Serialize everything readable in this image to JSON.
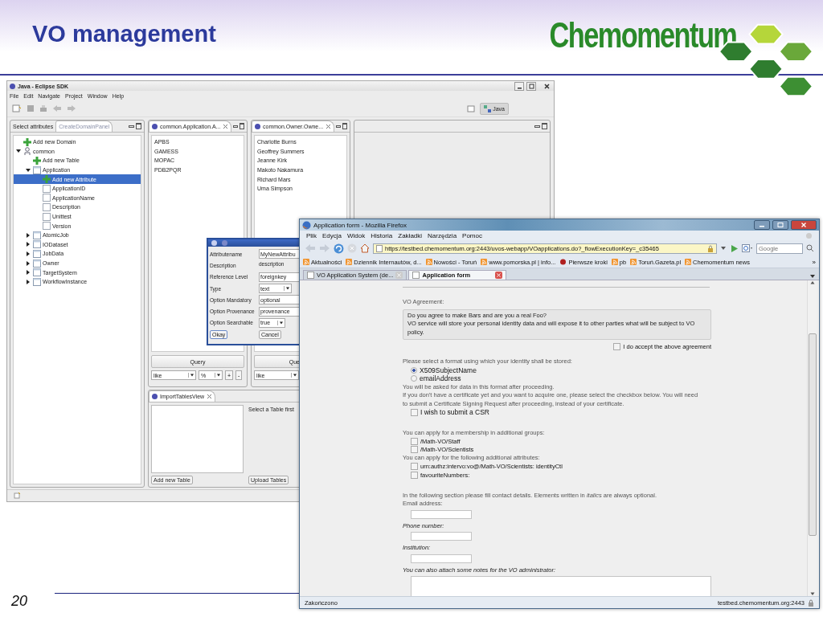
{
  "slide": {
    "title": "VO management",
    "logo": "Chemomentum",
    "page_number": "20"
  },
  "eclipse": {
    "title": "Java - Eclipse SDK",
    "menu": [
      "File",
      "Edit",
      "Navigate",
      "Project",
      "Window",
      "Help"
    ],
    "perspective": "Java",
    "left_tabs": [
      {
        "label": "Select attributes",
        "selected": false
      },
      {
        "label": "CreateDomainPanel",
        "selected": true
      }
    ],
    "tree": [
      {
        "label": "Add new Domain",
        "kind": "add",
        "selected": false
      },
      {
        "label": "common",
        "kind": "db",
        "selected": false,
        "expanded": true,
        "children": [
          {
            "label": "Add new Table",
            "kind": "add",
            "selected": false
          },
          {
            "label": "Application",
            "kind": "table",
            "selected": false,
            "expanded": true,
            "children": [
              {
                "label": "Add new Attribute",
                "kind": "add",
                "selected": true
              },
              {
                "label": "ApplicationID",
                "kind": "field",
                "selected": false
              },
              {
                "label": "ApplicationName",
                "kind": "field",
                "selected": false
              },
              {
                "label": "Description",
                "kind": "field",
                "selected": false
              },
              {
                "label": "Unittest",
                "kind": "field",
                "selected": false
              },
              {
                "label": "Version",
                "kind": "field",
                "selected": false
              }
            ]
          },
          {
            "label": "AtomicJob",
            "kind": "table",
            "selected": false,
            "expanded": false
          },
          {
            "label": "IODataset",
            "kind": "table",
            "selected": false,
            "expanded": false
          },
          {
            "label": "JobData",
            "kind": "table",
            "selected": false,
            "expanded": false
          },
          {
            "label": "Owner",
            "kind": "table",
            "selected": false,
            "expanded": false
          },
          {
            "label": "TargetSystem",
            "kind": "table",
            "selected": false,
            "expanded": false
          },
          {
            "label": "WorkflowInstance",
            "kind": "table",
            "selected": false,
            "expanded": false
          }
        ]
      }
    ],
    "views": [
      {
        "tab": "common.Application.A...",
        "items": [
          "APBS",
          "GAMESS",
          "MOPAC",
          "PDB2PQR"
        ],
        "query_button": "Query",
        "operator": "like",
        "pattern": "%",
        "buttons": [
          "+",
          "-"
        ]
      },
      {
        "tab": "common.Owner.Owne...",
        "items": [
          "Charlotte Burns",
          "Geoffrey Summers",
          "Jeanne Kirk",
          "Makoto Nakamura",
          "Richard Mars",
          "Uma Simpson"
        ],
        "query_button": "Que",
        "operator": "like"
      }
    ],
    "import_view": {
      "tab": "ImportTablesView",
      "hint": "Select a Table first",
      "buttons": [
        "Add new Table",
        "Upload Tables"
      ]
    }
  },
  "dialog": {
    "fields": [
      {
        "label": "Attributename",
        "kind": "text",
        "value": "MyNewAttribu"
      },
      {
        "label": "Description",
        "kind": "area",
        "value": "description"
      },
      {
        "label": "Reference Level",
        "kind": "text",
        "value": "foreignkey"
      },
      {
        "label": "Type",
        "kind": "select",
        "value": "text"
      },
      {
        "label": "Option Mandatory",
        "kind": "text",
        "value": "optional"
      },
      {
        "label": "Option Provenance",
        "kind": "text",
        "value": "provenance"
      },
      {
        "label": "Option Searchable",
        "kind": "select",
        "value": "true"
      }
    ],
    "buttons": [
      "Okay",
      "Cancel"
    ]
  },
  "firefox": {
    "title": "Application form - Mozilla Firefox",
    "menu": [
      "Plik",
      "Edycja",
      "Widok",
      "Historia",
      "Zakładki",
      "Narzędzia",
      "Pomoc"
    ],
    "url": "https://testbed.chemomentum.org:2443/uvos-webapp/VOapplications.do?_flowExecutionKey=_c35465",
    "search_placeholder": "Google",
    "bookmarks": [
      {
        "label": "Aktualności",
        "kind": "feed"
      },
      {
        "label": "Dziennik Internautów, d...",
        "kind": "feed"
      },
      {
        "label": "Nowości - Toruń",
        "kind": "feed"
      },
      {
        "label": "www.pomorska.pl | info...",
        "kind": "feed"
      },
      {
        "label": "Pierwsze kroki",
        "kind": "page"
      },
      {
        "label": "pb",
        "kind": "feed"
      },
      {
        "label": "Toruń.Gazeta.pl",
        "kind": "feed"
      },
      {
        "label": "Chemomentum news",
        "kind": "feed"
      }
    ],
    "bookmarks_more": "»",
    "tabs": [
      {
        "label": "VO Application System (de...",
        "selected": false
      },
      {
        "label": "Application form",
        "selected": true
      }
    ],
    "page": {
      "agreement": {
        "heading": "VO Agreement:",
        "lines": [
          "Do you agree to make Bars and are you a real Foo?",
          "VO service will store your personal identity data and will expose it to other parties what will be subject to VO policy."
        ],
        "accept": {
          "label": "I do accept the above agreement",
          "checked": false
        }
      },
      "format": {
        "prompt": "Please select a format using which your identity shall be stored:",
        "options": [
          {
            "label": "X509SubjectName",
            "selected": true
          },
          {
            "label": "emailAddress",
            "selected": false
          }
        ],
        "note": "You will be asked for data in this format after proceeding.",
        "csr_note": "If you don't have a certificate yet and you want to acquire one, please select the checkbox below. You will need to submit a Certificate Signing Request after proceeding, instead of your certificate.",
        "csr": {
          "label": "I wish to submit a CSR",
          "checked": false
        }
      },
      "groups": {
        "prompt": "You can apply for a membership in additional groups:",
        "options": [
          {
            "label": "/Math-VO/Staff",
            "checked": false
          },
          {
            "label": "/Math-VO/Scientists",
            "checked": false
          }
        ]
      },
      "attributes": {
        "prompt": "You can apply for the following additional attributes:",
        "options": [
          {
            "label": "urn:authz:intervo:vo@/Math-VO/Scientists: identityCtl",
            "checked": false
          },
          {
            "label": "favouriteNumbers:",
            "checked": false
          }
        ]
      },
      "contact": {
        "intro": "In the following section please fill contact details. Elements written in *italics* are always optional.",
        "fields": [
          {
            "label": "Email address:",
            "optional": false,
            "kind": "input"
          },
          {
            "label": "Phone number:",
            "optional": true,
            "kind": "input"
          },
          {
            "label": "Institution:",
            "optional": true,
            "kind": "input"
          },
          {
            "label": "You can also attach some notes for the VO administrator:",
            "optional": true,
            "kind": "textarea"
          }
        ]
      }
    },
    "status": "Zakończono",
    "status_host": "testbed.chemomentum.org:2443"
  }
}
